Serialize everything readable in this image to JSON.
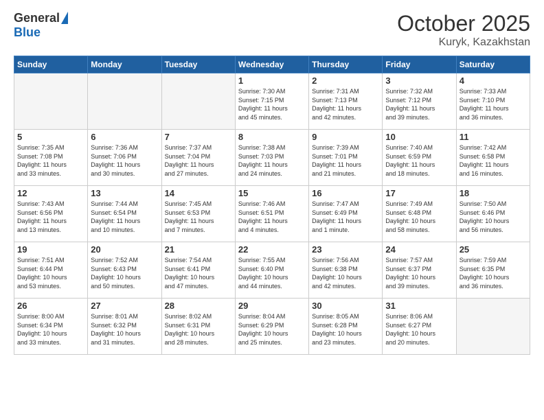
{
  "header": {
    "logo_general": "General",
    "logo_blue": "Blue",
    "month_title": "October 2025",
    "subtitle": "Kuryk, Kazakhstan"
  },
  "weekdays": [
    "Sunday",
    "Monday",
    "Tuesday",
    "Wednesday",
    "Thursday",
    "Friday",
    "Saturday"
  ],
  "weeks": [
    [
      {
        "day": "",
        "info": ""
      },
      {
        "day": "",
        "info": ""
      },
      {
        "day": "",
        "info": ""
      },
      {
        "day": "1",
        "info": "Sunrise: 7:30 AM\nSunset: 7:15 PM\nDaylight: 11 hours\nand 45 minutes."
      },
      {
        "day": "2",
        "info": "Sunrise: 7:31 AM\nSunset: 7:13 PM\nDaylight: 11 hours\nand 42 minutes."
      },
      {
        "day": "3",
        "info": "Sunrise: 7:32 AM\nSunset: 7:12 PM\nDaylight: 11 hours\nand 39 minutes."
      },
      {
        "day": "4",
        "info": "Sunrise: 7:33 AM\nSunset: 7:10 PM\nDaylight: 11 hours\nand 36 minutes."
      }
    ],
    [
      {
        "day": "5",
        "info": "Sunrise: 7:35 AM\nSunset: 7:08 PM\nDaylight: 11 hours\nand 33 minutes."
      },
      {
        "day": "6",
        "info": "Sunrise: 7:36 AM\nSunset: 7:06 PM\nDaylight: 11 hours\nand 30 minutes."
      },
      {
        "day": "7",
        "info": "Sunrise: 7:37 AM\nSunset: 7:04 PM\nDaylight: 11 hours\nand 27 minutes."
      },
      {
        "day": "8",
        "info": "Sunrise: 7:38 AM\nSunset: 7:03 PM\nDaylight: 11 hours\nand 24 minutes."
      },
      {
        "day": "9",
        "info": "Sunrise: 7:39 AM\nSunset: 7:01 PM\nDaylight: 11 hours\nand 21 minutes."
      },
      {
        "day": "10",
        "info": "Sunrise: 7:40 AM\nSunset: 6:59 PM\nDaylight: 11 hours\nand 18 minutes."
      },
      {
        "day": "11",
        "info": "Sunrise: 7:42 AM\nSunset: 6:58 PM\nDaylight: 11 hours\nand 16 minutes."
      }
    ],
    [
      {
        "day": "12",
        "info": "Sunrise: 7:43 AM\nSunset: 6:56 PM\nDaylight: 11 hours\nand 13 minutes."
      },
      {
        "day": "13",
        "info": "Sunrise: 7:44 AM\nSunset: 6:54 PM\nDaylight: 11 hours\nand 10 minutes."
      },
      {
        "day": "14",
        "info": "Sunrise: 7:45 AM\nSunset: 6:53 PM\nDaylight: 11 hours\nand 7 minutes."
      },
      {
        "day": "15",
        "info": "Sunrise: 7:46 AM\nSunset: 6:51 PM\nDaylight: 11 hours\nand 4 minutes."
      },
      {
        "day": "16",
        "info": "Sunrise: 7:47 AM\nSunset: 6:49 PM\nDaylight: 11 hours\nand 1 minute."
      },
      {
        "day": "17",
        "info": "Sunrise: 7:49 AM\nSunset: 6:48 PM\nDaylight: 10 hours\nand 58 minutes."
      },
      {
        "day": "18",
        "info": "Sunrise: 7:50 AM\nSunset: 6:46 PM\nDaylight: 10 hours\nand 56 minutes."
      }
    ],
    [
      {
        "day": "19",
        "info": "Sunrise: 7:51 AM\nSunset: 6:44 PM\nDaylight: 10 hours\nand 53 minutes."
      },
      {
        "day": "20",
        "info": "Sunrise: 7:52 AM\nSunset: 6:43 PM\nDaylight: 10 hours\nand 50 minutes."
      },
      {
        "day": "21",
        "info": "Sunrise: 7:54 AM\nSunset: 6:41 PM\nDaylight: 10 hours\nand 47 minutes."
      },
      {
        "day": "22",
        "info": "Sunrise: 7:55 AM\nSunset: 6:40 PM\nDaylight: 10 hours\nand 44 minutes."
      },
      {
        "day": "23",
        "info": "Sunrise: 7:56 AM\nSunset: 6:38 PM\nDaylight: 10 hours\nand 42 minutes."
      },
      {
        "day": "24",
        "info": "Sunrise: 7:57 AM\nSunset: 6:37 PM\nDaylight: 10 hours\nand 39 minutes."
      },
      {
        "day": "25",
        "info": "Sunrise: 7:59 AM\nSunset: 6:35 PM\nDaylight: 10 hours\nand 36 minutes."
      }
    ],
    [
      {
        "day": "26",
        "info": "Sunrise: 8:00 AM\nSunset: 6:34 PM\nDaylight: 10 hours\nand 33 minutes."
      },
      {
        "day": "27",
        "info": "Sunrise: 8:01 AM\nSunset: 6:32 PM\nDaylight: 10 hours\nand 31 minutes."
      },
      {
        "day": "28",
        "info": "Sunrise: 8:02 AM\nSunset: 6:31 PM\nDaylight: 10 hours\nand 28 minutes."
      },
      {
        "day": "29",
        "info": "Sunrise: 8:04 AM\nSunset: 6:29 PM\nDaylight: 10 hours\nand 25 minutes."
      },
      {
        "day": "30",
        "info": "Sunrise: 8:05 AM\nSunset: 6:28 PM\nDaylight: 10 hours\nand 23 minutes."
      },
      {
        "day": "31",
        "info": "Sunrise: 8:06 AM\nSunset: 6:27 PM\nDaylight: 10 hours\nand 20 minutes."
      },
      {
        "day": "",
        "info": ""
      }
    ]
  ]
}
